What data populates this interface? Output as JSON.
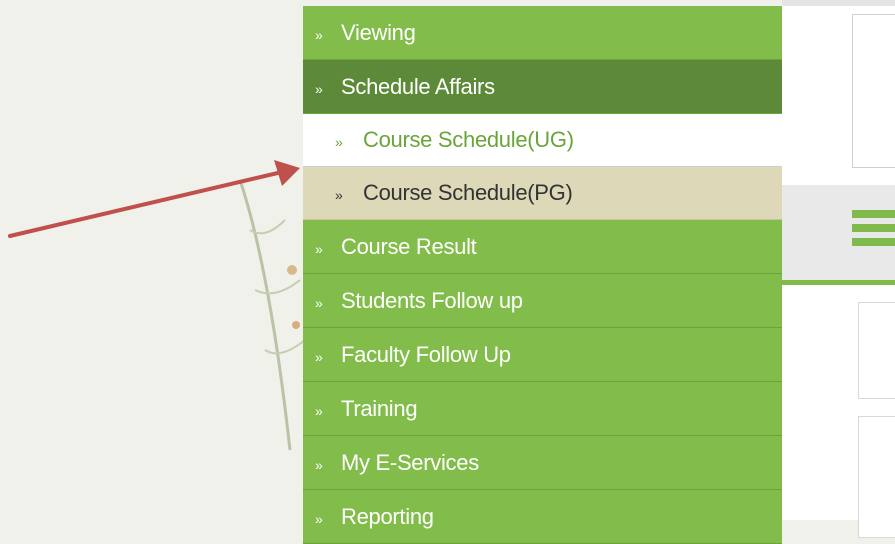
{
  "menu": {
    "items": [
      {
        "label": "Viewing",
        "icon": "double-chevron",
        "state": "normal"
      },
      {
        "label": "Schedule Affairs",
        "icon": "double-chevron",
        "state": "active"
      },
      {
        "label": "Course Schedule(UG)",
        "icon": "double-chevron",
        "state": "sub-selected"
      },
      {
        "label": "Course Schedule(PG)",
        "icon": "double-chevron",
        "state": "sub"
      },
      {
        "label": "Course Result",
        "icon": "double-chevron",
        "state": "normal"
      },
      {
        "label": "Students Follow up",
        "icon": "double-chevron",
        "state": "normal"
      },
      {
        "label": "Faculty Follow Up",
        "icon": "double-chevron",
        "state": "normal"
      },
      {
        "label": "Training",
        "icon": "double-chevron",
        "state": "normal"
      },
      {
        "label": "My E-Services",
        "icon": "double-chevron",
        "state": "normal"
      },
      {
        "label": "Reporting",
        "icon": "double-chevron",
        "state": "normal"
      }
    ],
    "bullet_glyph": "»"
  },
  "colors": {
    "menu_green": "#82bc4a",
    "menu_active": "#5d8a38",
    "submenu_bg": "#ddd8b8",
    "arrow": "#c0504d"
  }
}
